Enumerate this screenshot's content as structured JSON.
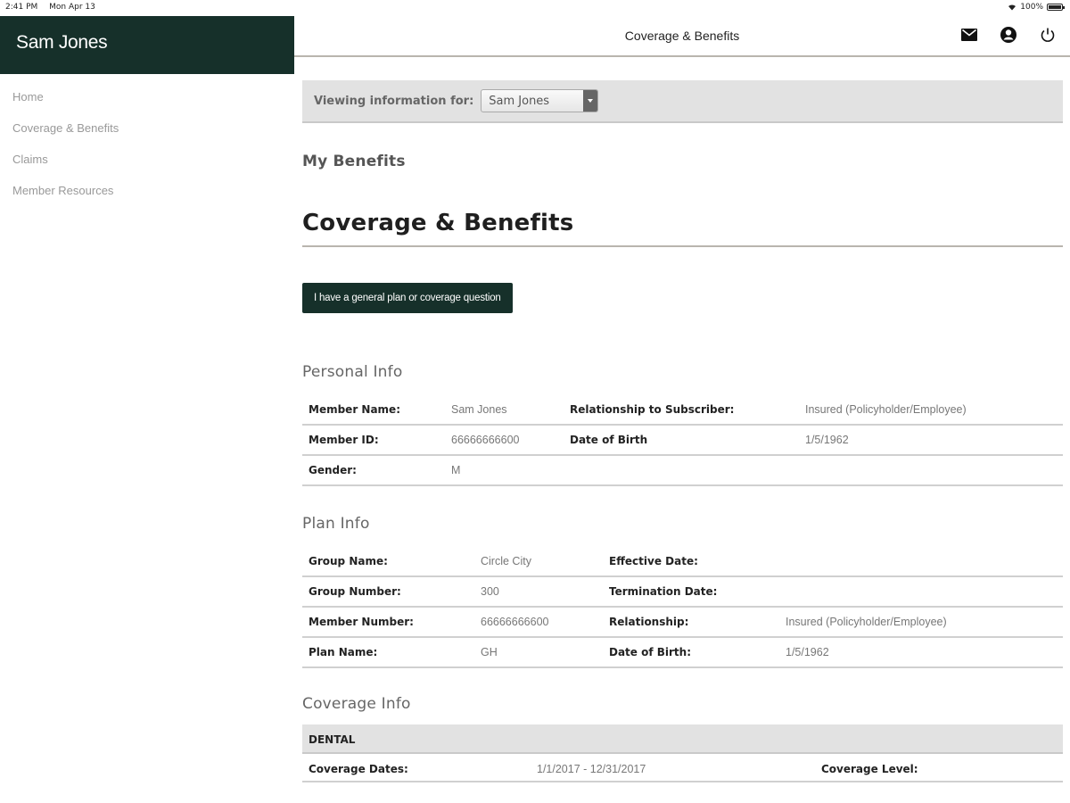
{
  "status": {
    "time": "2:41 PM",
    "date": "Mon Apr 13",
    "battery": "100%"
  },
  "sidebar": {
    "user_name": "Sam Jones",
    "items": [
      {
        "label": "Home"
      },
      {
        "label": "Coverage & Benefits"
      },
      {
        "label": "Claims"
      },
      {
        "label": "Member Resources"
      }
    ]
  },
  "topbar": {
    "title": "Coverage & Benefits",
    "icons": [
      "mail-icon",
      "account-icon",
      "power-icon"
    ]
  },
  "viewing": {
    "label": "Viewing information for:",
    "selected": "Sam Jones"
  },
  "main": {
    "subheading": "My Benefits",
    "title": "Coverage & Benefits",
    "question_button": "I have a general plan or coverage question"
  },
  "personal": {
    "heading": "Personal Info",
    "rows": [
      [
        "Member Name:",
        "Sam Jones",
        "Relationship to Subscriber:",
        "Insured (Policyholder/Employee)"
      ],
      [
        "Member ID:",
        "66666666600",
        "Date of Birth",
        "1/5/1962"
      ],
      [
        "Gender:",
        "M",
        "",
        ""
      ]
    ]
  },
  "plan": {
    "heading": "Plan Info",
    "rows": [
      [
        "Group Name:",
        "Circle City",
        "Effective Date:",
        ""
      ],
      [
        "Group Number:",
        "300",
        "Termination Date:",
        ""
      ],
      [
        "Member Number:",
        "66666666600",
        "Relationship:",
        "Insured (Policyholder/Employee)"
      ],
      [
        "Plan Name:",
        "GH",
        "Date of Birth:",
        "1/5/1962"
      ]
    ]
  },
  "coverage": {
    "heading": "Coverage Info",
    "group": "DENTAL",
    "row": {
      "dates_label": "Coverage Dates:",
      "dates": "1/1/2017 - 12/31/2017",
      "level_label": "Coverage Level:",
      "level": ""
    }
  },
  "colors": {
    "brand": "#16302a",
    "divider": "#b9b5ae",
    "panel": "#e2e2e2"
  }
}
